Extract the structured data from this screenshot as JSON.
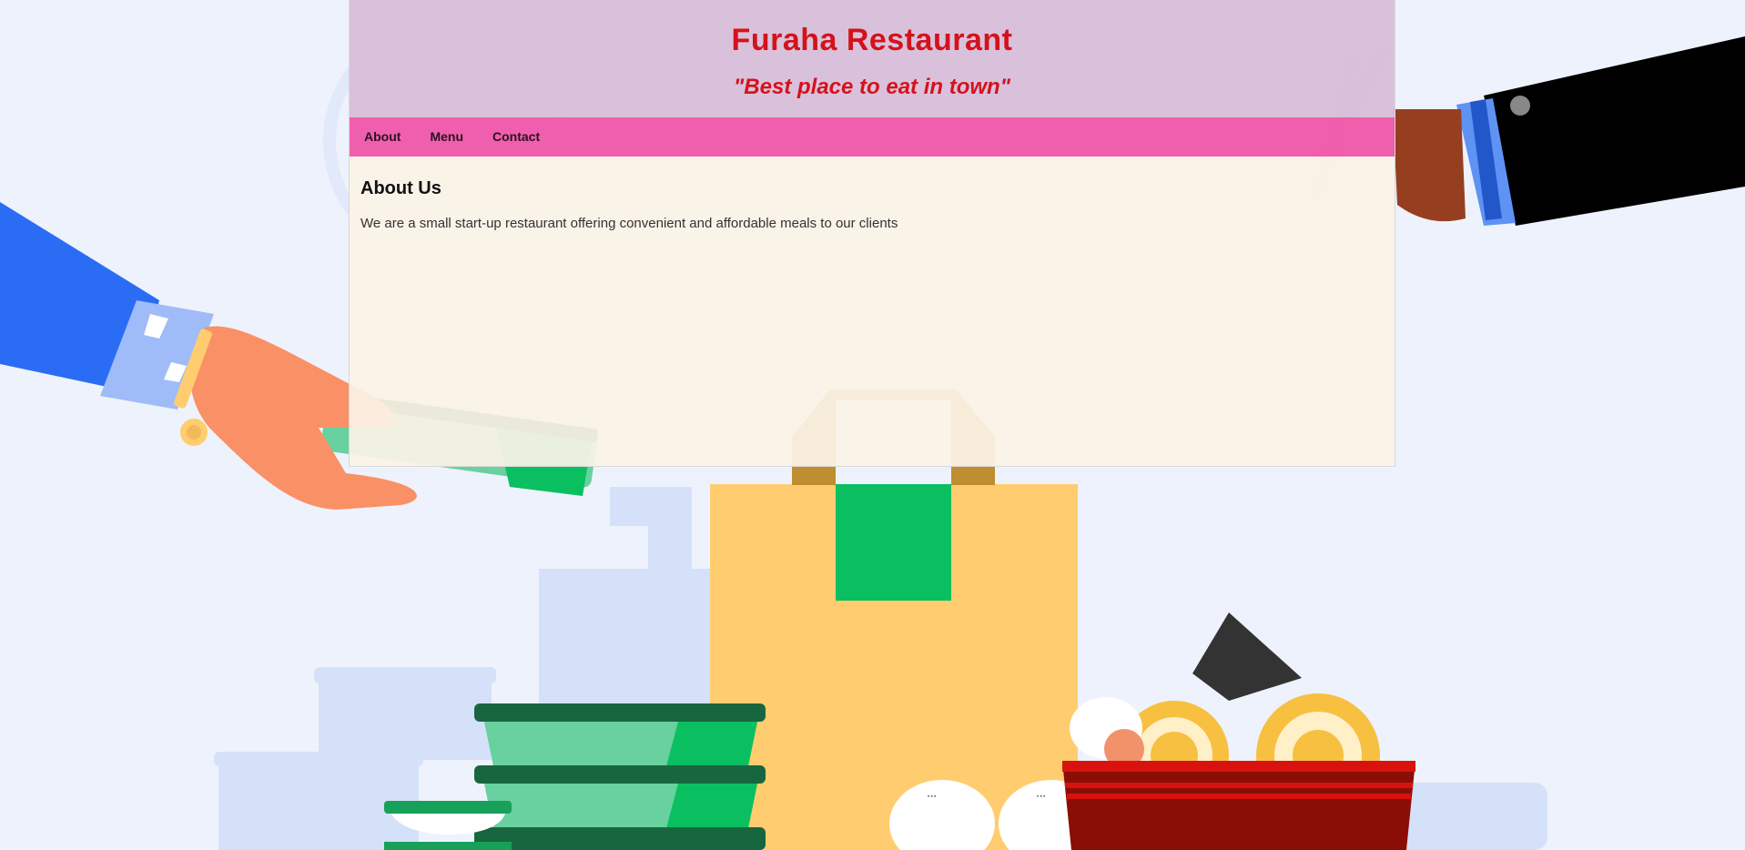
{
  "header": {
    "title": "Furaha Restaurant",
    "tagline": "\"Best place to eat in town\""
  },
  "nav": {
    "items": [
      {
        "label": "About"
      },
      {
        "label": "Menu"
      },
      {
        "label": "Contact"
      }
    ]
  },
  "main": {
    "section_title": "About Us",
    "section_text": "We are a small start-up restaurant offering convenient and affordable meals to our clients"
  },
  "colors": {
    "page_background": "#eef2fc",
    "header_background": "#d8bed9",
    "title_red": "#d4121c",
    "navbar_pink": "#f05aaa",
    "content_background": "#fbf3e6"
  }
}
